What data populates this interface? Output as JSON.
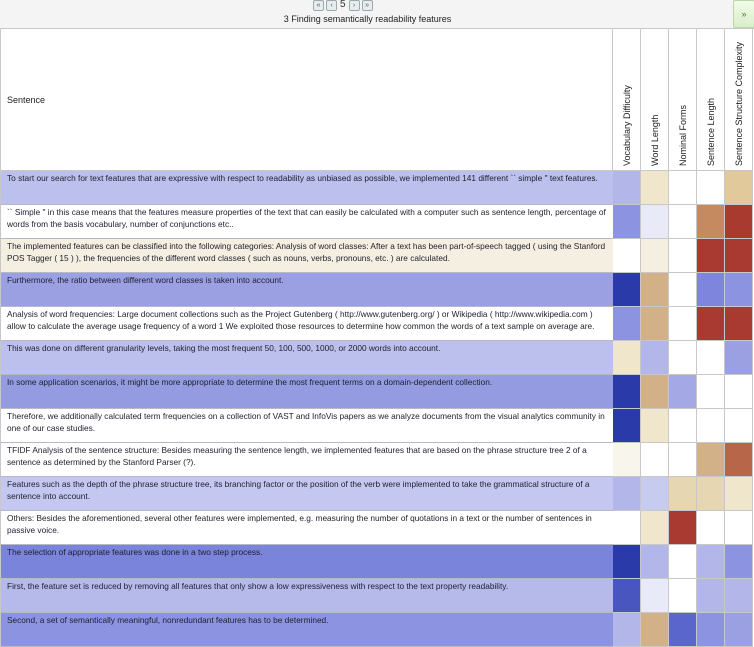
{
  "pager": {
    "first_label": "«",
    "prev_label": "‹",
    "page": "5",
    "next_label": "›",
    "last_label": "»"
  },
  "section_title": "3 Finding semantically readability features",
  "corner_button_label": "»",
  "table": {
    "sentence_header": "Sentence",
    "feature_headers": [
      "Vocabulary Difficulty",
      "Word Length",
      "Nominal Forms",
      "Sentence Length",
      "Sentence Structure Complexity"
    ],
    "rows": [
      {
        "text": "To start our search for text features that are expressive with respect to readability as unbiased as possible, we implemented 141 different `` simple \" text features.",
        "bg": "#bcc0ec",
        "cells": [
          "#b2b6e8",
          "#efe6cc",
          "#ffffff",
          "#ffffff",
          "#e2c99c"
        ]
      },
      {
        "text": "`` Simple \" in this case means that the features measure properties of the text that can easily be calculated with a computer such as sentence length, percentage of words from the basis vocabulary, number of conjunctions etc..",
        "bg": "#ffffff",
        "cells": [
          "#8c94e2",
          "#e8eaf8",
          "#ffffff",
          "#c68a60",
          "#a93a30"
        ]
      },
      {
        "text": "The implemented features can be classified into the following categories: Analysis of word classes: After a text has been part-of-speech tagged ( using the Stanford POS Tagger ( 15 ) ), the frequencies of the different word classes ( such as nouns, verbs, pronouns, etc. ) are calculated.",
        "bg": "#f4efe0",
        "cells": [
          "#ffffff",
          "#f4efe0",
          "#ffffff",
          "#a83a32",
          "#a83a32"
        ]
      },
      {
        "text": "Furthermore, the ratio between different word classes is taken into account.",
        "bg": "#9aa0e2",
        "cells": [
          "#2a3aa8",
          "#d2b088",
          "#ffffff",
          "#7d86dc",
          "#8c94e2"
        ]
      },
      {
        "text": "Analysis of word frequencies: Large document collections such as the Project Gutenberg ( http://www.gutenberg.org/ ) or Wikipedia ( http://www.wikipedia.com ) allow to calculate the average usage frequency of a word 1 We exploited those resources to determine how common the words of a text sample on average are.",
        "bg": "#ffffff",
        "cells": [
          "#8c94e2",
          "#d2b088",
          "#ffffff",
          "#a83a32",
          "#a83a32"
        ]
      },
      {
        "text": "This was done on different granularity levels, taking the most frequent 50, 100, 500, 1000, or 2000 words into account.",
        "bg": "#bcc0ec",
        "cells": [
          "#efe6cc",
          "#b2b6e8",
          "#ffffff",
          "#ffffff",
          "#9aa0e2"
        ]
      },
      {
        "text": "In some application scenarios, it might be more appropriate to determine the most frequent terms on a domain-dependent collection.",
        "bg": "#959be0",
        "cells": [
          "#2a3aa8",
          "#d2b088",
          "#a4a9e6",
          "#ffffff",
          "#ffffff"
        ]
      },
      {
        "text": "Therefore, we additionally calculated term frequencies on a collection of VAST and InfoVis papers as we analyze documents from the visual analytics community in one of our case studies.",
        "bg": "#ffffff",
        "cells": [
          "#2a3aa8",
          "#efe6cc",
          "#ffffff",
          "#ffffff",
          "#ffffff"
        ]
      },
      {
        "text": "TFIDF Analysis of the sentence structure: Besides measuring the sentence length, we implemented features that are based on the phrase structure tree 2 of a sentence as determined by the Stanford Parser (?).",
        "bg": "#ffffff",
        "cells": [
          "#f8f5ec",
          "#ffffff",
          "#ffffff",
          "#d2b088",
          "#b8664a"
        ]
      },
      {
        "text": "Features such as the depth of the phrase structure tree, its branching factor or the position of the verb were implemented to take the grammatical structure of a sentence into account.",
        "bg": "#c4c8f0",
        "cells": [
          "#b2b6e8",
          "#c8cbf0",
          "#e6d6b2",
          "#e6d6b2",
          "#efe6cc"
        ]
      },
      {
        "text": "Others: Besides the aforementioned, several other features were implemented, e.g. measuring the number of quotations in a text or the number of sentences in passive voice.",
        "bg": "#ffffff",
        "cells": [
          "#ffffff",
          "#efe6cc",
          "#a83a32",
          "#ffffff",
          "#ffffff"
        ]
      },
      {
        "text": "The selection of appropriate features was done in a two step process.",
        "bg": "#7a84da",
        "cells": [
          "#2a3aa8",
          "#b2b6e8",
          "#ffffff",
          "#b2b6e8",
          "#8c94e2"
        ]
      },
      {
        "text": "First, the feature set is reduced by removing all features that only show a low expressiveness with respect to the text property readability.",
        "bg": "#b6baea",
        "cells": [
          "#4a56c0",
          "#e8eaf8",
          "#ffffff",
          "#b2b6e8",
          "#b2b6e8"
        ]
      },
      {
        "text": "Second, a set of semantically meaningful, nonredundant features has to be determined.",
        "bg": "#8c94e2",
        "cells": [
          "#b2b6e8",
          "#d2b088",
          "#5a66cc",
          "#8c94e2",
          "#9aa0e2"
        ]
      }
    ]
  }
}
